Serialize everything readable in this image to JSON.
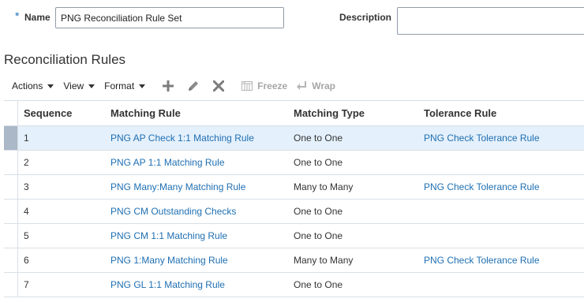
{
  "form": {
    "required_marker": "*",
    "name_label": "Name",
    "name_value": "PNG Reconciliation Rule Set",
    "description_label": "Description",
    "description_value": ""
  },
  "section_title": "Reconciliation Rules",
  "toolbar": {
    "actions_label": "Actions",
    "view_label": "View",
    "format_label": "Format",
    "freeze_label": "Freeze",
    "wrap_label": "Wrap"
  },
  "table": {
    "headers": {
      "sequence": "Sequence",
      "matching_rule": "Matching Rule",
      "matching_type": "Matching Type",
      "tolerance_rule": "Tolerance Rule"
    },
    "rows": [
      {
        "sequence": "1",
        "matching_rule": "PNG AP Check 1:1 Matching Rule",
        "matching_type": "One to One",
        "tolerance_rule": "PNG Check Tolerance Rule"
      },
      {
        "sequence": "2",
        "matching_rule": "PNG AP 1:1 Matching Rule",
        "matching_type": "One to One",
        "tolerance_rule": ""
      },
      {
        "sequence": "3",
        "matching_rule": "PNG Many:Many Matching Rule",
        "matching_type": "Many to Many",
        "tolerance_rule": "PNG Check Tolerance Rule"
      },
      {
        "sequence": "4",
        "matching_rule": "PNG CM Outstanding Checks",
        "matching_type": "One to One",
        "tolerance_rule": ""
      },
      {
        "sequence": "5",
        "matching_rule": "PNG CM 1:1 Matching Rule",
        "matching_type": "One to One",
        "tolerance_rule": ""
      },
      {
        "sequence": "6",
        "matching_rule": "PNG 1:Many Matching Rule",
        "matching_type": "Many to Many",
        "tolerance_rule": "PNG Check Tolerance Rule"
      },
      {
        "sequence": "7",
        "matching_rule": "PNG GL 1:1 Matching Rule",
        "matching_type": "One to One",
        "tolerance_rule": ""
      }
    ]
  },
  "colors": {
    "link": "#1f6fb2",
    "selected_row": "#e4f0fb",
    "selected_handle": "#aab8c8",
    "disabled_tool": "#a6a6a6"
  }
}
